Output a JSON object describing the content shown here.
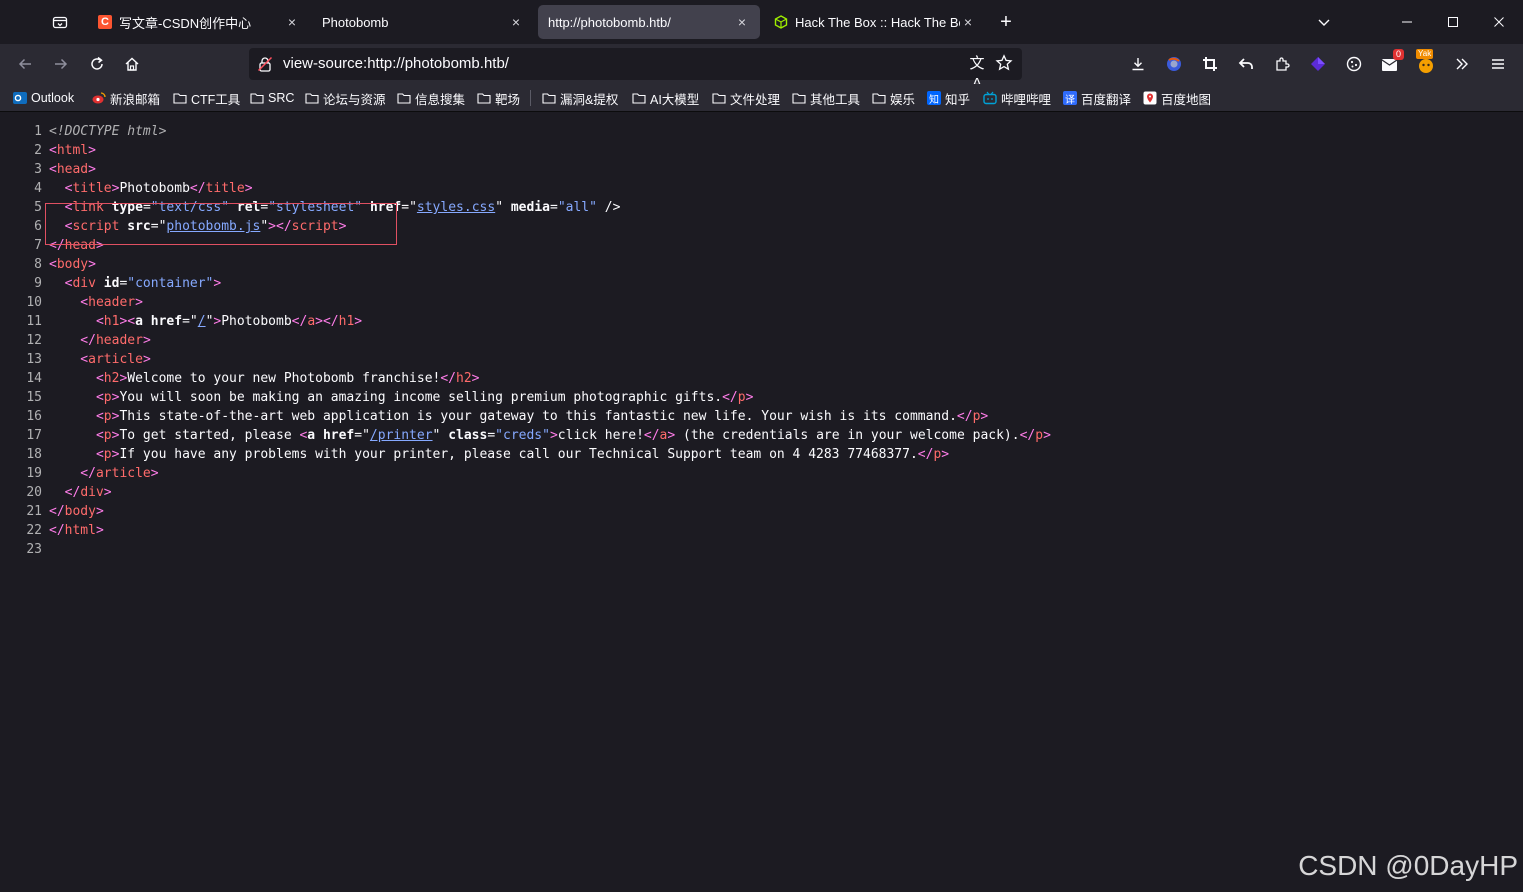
{
  "tabs": [
    {
      "label": "写文章-CSDN创作中心",
      "favicon": "csdn-icon",
      "favicon_letter": "C",
      "active": false
    },
    {
      "label": "Photobomb",
      "favicon": "",
      "active": false
    },
    {
      "label": "http://photobomb.htb/",
      "favicon": "",
      "active": true
    },
    {
      "label": "Hack The Box :: Hack The Box",
      "favicon": "htb-cube-icon",
      "active": false
    }
  ],
  "tab_close_glyph": "×",
  "new_tab_glyph": "+",
  "url": "view-source:http://photobomb.htb/",
  "translate_glyph": "文A",
  "ext_badges": {
    "mail": "0",
    "yak": "Yak"
  },
  "bookmarks": [
    {
      "label": "Outlook",
      "icon": "outlook-icon"
    },
    {
      "label": "新浪邮箱",
      "icon": "sina-icon"
    },
    {
      "label": "CTF工具",
      "icon": "folder-icon"
    },
    {
      "label": "SRC",
      "icon": "folder-icon"
    },
    {
      "label": "论坛与资源",
      "icon": "folder-icon"
    },
    {
      "label": "信息搜集",
      "icon": "folder-icon"
    },
    {
      "label": "靶场",
      "icon": "folder-icon"
    },
    {
      "label": "漏洞&提权",
      "icon": "folder-icon"
    },
    {
      "label": "AI大模型",
      "icon": "folder-icon"
    },
    {
      "label": "文件处理",
      "icon": "folder-icon"
    },
    {
      "label": "其他工具",
      "icon": "folder-icon"
    },
    {
      "label": "娱乐",
      "icon": "folder-icon"
    },
    {
      "label": "知乎",
      "icon": "zhihu-icon",
      "icon_text": "知"
    },
    {
      "label": "哔哩哔哩",
      "icon": "bilibili-icon"
    },
    {
      "label": "百度翻译",
      "icon": "baidu-translate-icon",
      "icon_text": "译"
    },
    {
      "label": "百度地图",
      "icon": "baidu-map-icon"
    }
  ],
  "source_lines": [
    [
      [
        "dt",
        "<!DOCTYPE html>"
      ]
    ],
    [
      [
        "t",
        "<"
      ],
      [
        "tag",
        "html"
      ],
      [
        "t",
        ">"
      ]
    ],
    [
      [
        "t",
        "<"
      ],
      [
        "tag",
        "head"
      ],
      [
        "t",
        ">"
      ]
    ],
    [
      [
        "t",
        "  <"
      ],
      [
        "tag",
        "title"
      ],
      [
        "t",
        ">"
      ],
      [
        "x",
        "Photobomb"
      ],
      [
        "t",
        "</"
      ],
      [
        "tag",
        "title"
      ],
      [
        "t",
        ">"
      ]
    ],
    [
      [
        "t",
        "  <"
      ],
      [
        "tag",
        "link"
      ],
      [
        "x",
        " "
      ],
      [
        "an",
        "type"
      ],
      [
        "x",
        "="
      ],
      [
        "av",
        "\"text/css\""
      ],
      [
        "x",
        " "
      ],
      [
        "an",
        "rel"
      ],
      [
        "x",
        "="
      ],
      [
        "av",
        "\"stylesheet\""
      ],
      [
        "x",
        " "
      ],
      [
        "an",
        "href"
      ],
      [
        "x",
        "=\""
      ],
      [
        "lk",
        "styles.css"
      ],
      [
        "x",
        "\" "
      ],
      [
        "an",
        "media"
      ],
      [
        "x",
        "="
      ],
      [
        "av",
        "\"all\""
      ],
      [
        "x",
        " />"
      ]
    ],
    [
      [
        "t",
        "  <"
      ],
      [
        "tag",
        "script"
      ],
      [
        "x",
        " "
      ],
      [
        "an",
        "src"
      ],
      [
        "x",
        "=\""
      ],
      [
        "lk",
        "photobomb.js"
      ],
      [
        "x",
        "\""
      ],
      [
        "t",
        "></"
      ],
      [
        "tag",
        "script"
      ],
      [
        "t",
        ">"
      ]
    ],
    [
      [
        "t",
        "</"
      ],
      [
        "tag",
        "head"
      ],
      [
        "t",
        ">"
      ]
    ],
    [
      [
        "t",
        "<"
      ],
      [
        "tag",
        "body"
      ],
      [
        "t",
        ">"
      ]
    ],
    [
      [
        "t",
        "  <"
      ],
      [
        "tag",
        "div"
      ],
      [
        "x",
        " "
      ],
      [
        "an",
        "id"
      ],
      [
        "x",
        "="
      ],
      [
        "av",
        "\"container\""
      ],
      [
        "t",
        ">"
      ]
    ],
    [
      [
        "t",
        "    <"
      ],
      [
        "tag",
        "header"
      ],
      [
        "t",
        ">"
      ]
    ],
    [
      [
        "t",
        "      <"
      ],
      [
        "tag",
        "h1"
      ],
      [
        "t",
        "><"
      ],
      [
        "an",
        "a"
      ],
      [
        "x",
        " "
      ],
      [
        "an",
        "href"
      ],
      [
        "x",
        "=\""
      ],
      [
        "lk",
        "/"
      ],
      [
        "x",
        "\""
      ],
      [
        "t",
        ">"
      ],
      [
        "x",
        "Photobomb"
      ],
      [
        "t",
        "</"
      ],
      [
        "tag",
        "a"
      ],
      [
        "t",
        "></"
      ],
      [
        "tag",
        "h1"
      ],
      [
        "t",
        ">"
      ]
    ],
    [
      [
        "t",
        "    </"
      ],
      [
        "tag",
        "header"
      ],
      [
        "t",
        ">"
      ]
    ],
    [
      [
        "t",
        "    <"
      ],
      [
        "tag",
        "article"
      ],
      [
        "t",
        ">"
      ]
    ],
    [
      [
        "t",
        "      <"
      ],
      [
        "tag",
        "h2"
      ],
      [
        "t",
        ">"
      ],
      [
        "x",
        "Welcome to your new Photobomb franchise!"
      ],
      [
        "t",
        "</"
      ],
      [
        "tag",
        "h2"
      ],
      [
        "t",
        ">"
      ]
    ],
    [
      [
        "t",
        "      <"
      ],
      [
        "tag",
        "p"
      ],
      [
        "t",
        ">"
      ],
      [
        "x",
        "You will soon be making an amazing income selling premium photographic gifts."
      ],
      [
        "t",
        "</"
      ],
      [
        "tag",
        "p"
      ],
      [
        "t",
        ">"
      ]
    ],
    [
      [
        "t",
        "      <"
      ],
      [
        "tag",
        "p"
      ],
      [
        "t",
        ">"
      ],
      [
        "x",
        "This state-of-the-art web application is your gateway to this fantastic new life. Your wish is its command."
      ],
      [
        "t",
        "</"
      ],
      [
        "tag",
        "p"
      ],
      [
        "t",
        ">"
      ]
    ],
    [
      [
        "t",
        "      <"
      ],
      [
        "tag",
        "p"
      ],
      [
        "t",
        ">"
      ],
      [
        "x",
        "To get started, please "
      ],
      [
        "t",
        "<"
      ],
      [
        "an",
        "a"
      ],
      [
        "x",
        " "
      ],
      [
        "an",
        "href"
      ],
      [
        "x",
        "=\""
      ],
      [
        "lk",
        "/printer"
      ],
      [
        "x",
        "\" "
      ],
      [
        "an",
        "class"
      ],
      [
        "x",
        "="
      ],
      [
        "av",
        "\"creds\""
      ],
      [
        "t",
        ">"
      ],
      [
        "x",
        "click here!"
      ],
      [
        "t",
        "</"
      ],
      [
        "tag",
        "a"
      ],
      [
        "t",
        ">"
      ],
      [
        "x",
        " (the credentials are in your welcome pack)."
      ],
      [
        "t",
        "</"
      ],
      [
        "tag",
        "p"
      ],
      [
        "t",
        ">"
      ]
    ],
    [
      [
        "t",
        "      <"
      ],
      [
        "tag",
        "p"
      ],
      [
        "t",
        ">"
      ],
      [
        "x",
        "If you have any problems with your printer, please call our Technical Support team on 4 4283 77468377."
      ],
      [
        "t",
        "</"
      ],
      [
        "tag",
        "p"
      ],
      [
        "t",
        ">"
      ]
    ],
    [
      [
        "t",
        "    </"
      ],
      [
        "tag",
        "article"
      ],
      [
        "t",
        ">"
      ]
    ],
    [
      [
        "t",
        "  </"
      ],
      [
        "tag",
        "div"
      ],
      [
        "t",
        ">"
      ]
    ],
    [
      [
        "t",
        "</"
      ],
      [
        "tag",
        "body"
      ],
      [
        "t",
        ">"
      ]
    ],
    [
      [
        "t",
        "</"
      ],
      [
        "tag",
        "html"
      ],
      [
        "t",
        ">"
      ]
    ],
    []
  ],
  "watermark": "CSDN @0DayHP",
  "colors": {
    "tag": "#ff6b6b",
    "attr_value": "#86a9ff",
    "highlight": "#e05062"
  }
}
